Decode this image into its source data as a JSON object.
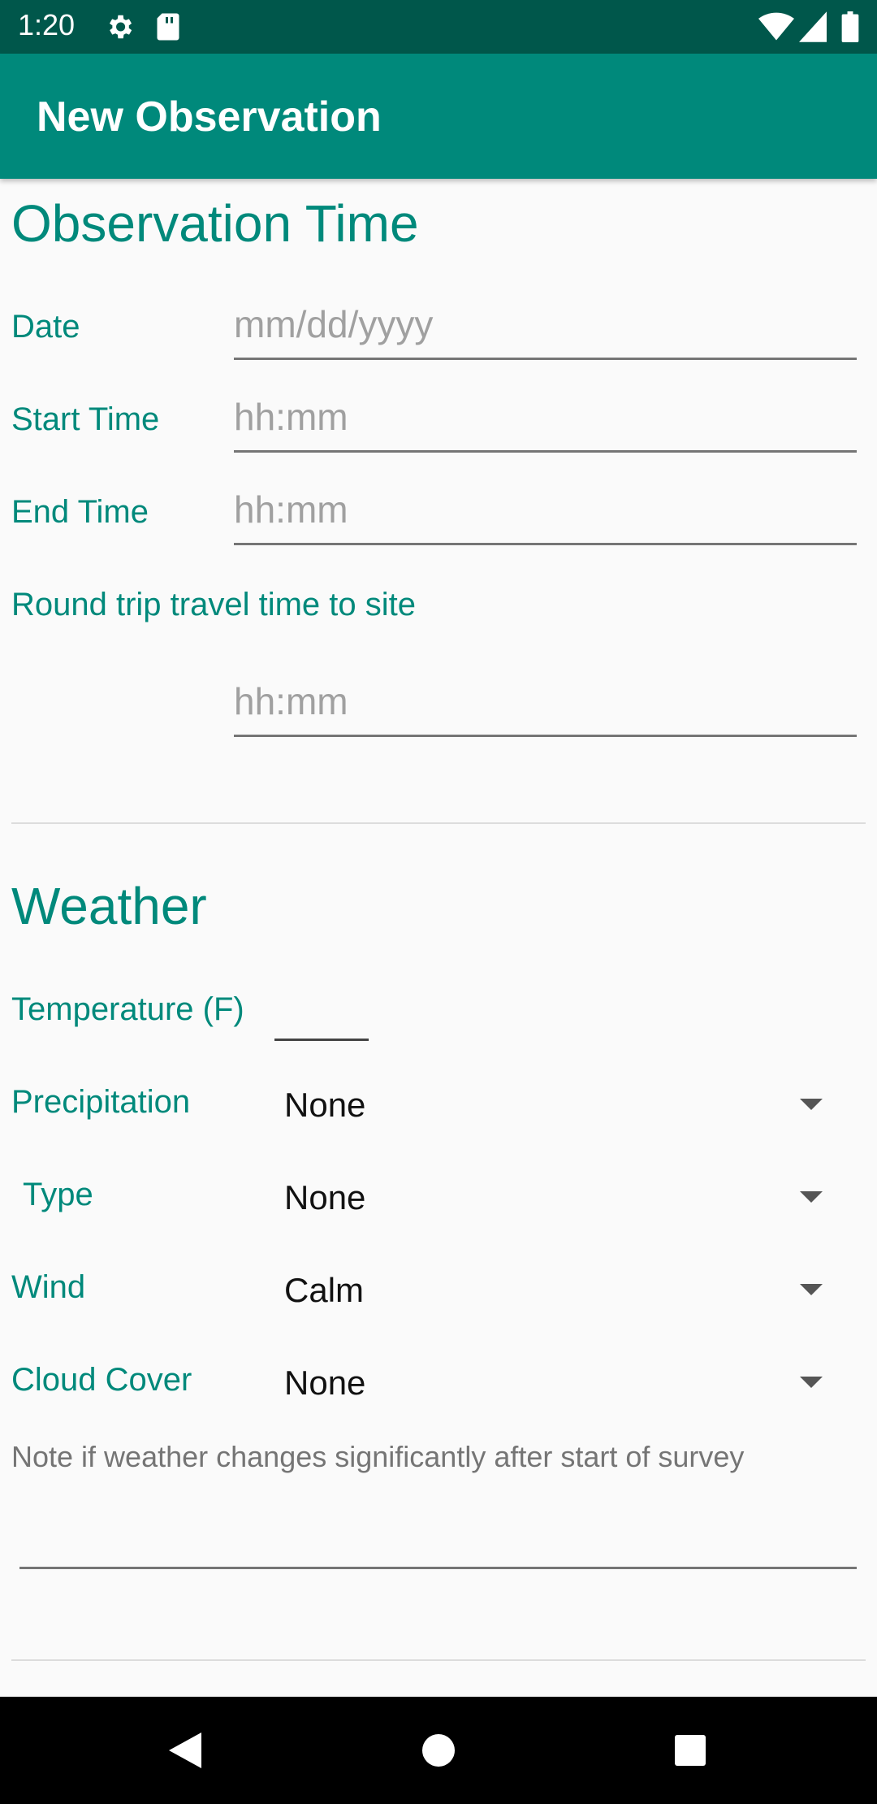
{
  "status_bar": {
    "time": "1:20",
    "icons": [
      "gear-icon",
      "sd-card-icon",
      "wifi-icon",
      "signal-icon",
      "battery-icon"
    ]
  },
  "app_bar": {
    "title": "New Observation"
  },
  "observation_time": {
    "heading": "Observation Time",
    "date": {
      "label": "Date",
      "placeholder": "mm/dd/yyyy"
    },
    "start_time": {
      "label": "Start Time",
      "placeholder": "hh:mm"
    },
    "end_time": {
      "label": "End Time",
      "placeholder": "hh:mm"
    },
    "travel_time": {
      "label": "Round trip travel time to site",
      "placeholder": "hh:mm"
    }
  },
  "weather": {
    "heading": "Weather",
    "temperature": {
      "label": "Temperature (F)",
      "value": ""
    },
    "precipitation": {
      "label": "Precipitation",
      "value": "None"
    },
    "type": {
      "label": "Type",
      "value": "None"
    },
    "wind": {
      "label": "Wind",
      "value": "Calm"
    },
    "cloud_cover": {
      "label": "Cloud Cover",
      "value": "None"
    },
    "note": {
      "placeholder": "Note if weather changes significantly after start of survey",
      "value": ""
    }
  },
  "colors": {
    "primary": "#00897b",
    "primary_dark": "#00574b",
    "accent_text": "#00897b"
  }
}
